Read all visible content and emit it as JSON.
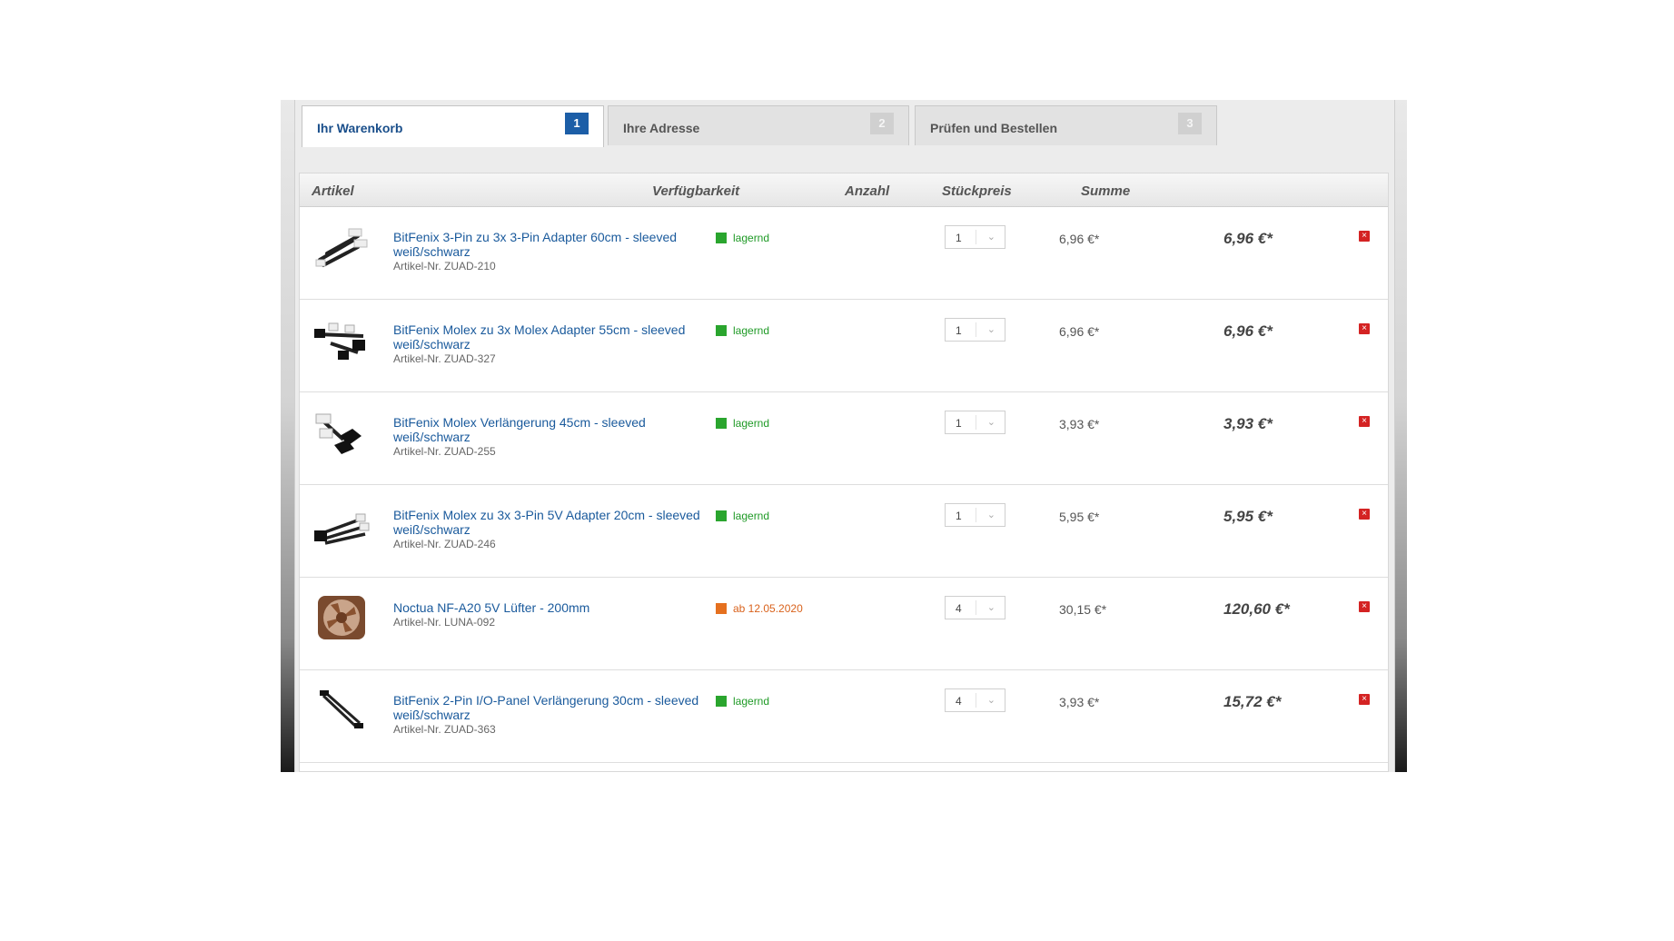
{
  "tabs": [
    {
      "label": "Ihr Warenkorb",
      "num": "1",
      "active": true
    },
    {
      "label": "Ihre Adresse",
      "num": "2",
      "active": false
    },
    {
      "label": "Prüfen und Bestellen",
      "num": "3",
      "active": false
    }
  ],
  "columns": {
    "artikel": "Artikel",
    "verfuegbarkeit": "Verfügbarkeit",
    "anzahl": "Anzahl",
    "stueckpreis": "Stückpreis",
    "summe": "Summe"
  },
  "items": [
    {
      "name": "BitFenix 3-Pin zu 3x 3-Pin Adapter 60cm - sleeved weiß/schwarz",
      "artnr": "Artikel-Nr. ZUAD-210",
      "availability": "lagernd",
      "status": "ok",
      "qty": "1",
      "unit_price": "6,96 €*",
      "sum": "6,96 €*",
      "thumb": "cable-adapter-image"
    },
    {
      "name": "BitFenix Molex zu 3x Molex Adapter 55cm - sleeved weiß/schwarz",
      "artnr": "Artikel-Nr. ZUAD-327",
      "availability": "lagernd",
      "status": "ok",
      "qty": "1",
      "unit_price": "6,96 €*",
      "sum": "6,96 €*",
      "thumb": "molex-adapter-image"
    },
    {
      "name": "BitFenix Molex Verlängerung 45cm - sleeved weiß/schwarz",
      "artnr": "Artikel-Nr. ZUAD-255",
      "availability": "lagernd",
      "status": "ok",
      "qty": "1",
      "unit_price": "3,93 €*",
      "sum": "3,93 €*",
      "thumb": "molex-extension-image"
    },
    {
      "name": "BitFenix Molex zu 3x 3-Pin 5V Adapter 20cm - sleeved weiß/schwarz",
      "artnr": "Artikel-Nr. ZUAD-246",
      "availability": "lagernd",
      "status": "ok",
      "qty": "1",
      "unit_price": "5,95 €*",
      "sum": "5,95 €*",
      "thumb": "molex-3pin-adapter-image"
    },
    {
      "name": "Noctua NF-A20 5V Lüfter - 200mm",
      "artnr": "Artikel-Nr. LUNA-092",
      "availability": "ab 12.05.2020",
      "status": "delayed",
      "qty": "4",
      "unit_price": "30,15 €*",
      "sum": "120,60 €*",
      "thumb": "fan-image"
    },
    {
      "name": "BitFenix 2-Pin I/O-Panel Verlängerung 30cm - sleeved weiß/schwarz",
      "artnr": "Artikel-Nr. ZUAD-363",
      "availability": "lagernd",
      "status": "ok",
      "qty": "4",
      "unit_price": "3,93 €*",
      "sum": "15,72 €*",
      "thumb": "io-panel-cable-image"
    }
  ],
  "icons": {
    "delete": "delete-icon",
    "dropdown": "chevron-down-icon"
  },
  "colors": {
    "link": "#1a5a9c",
    "in_stock": "#2aa52e",
    "delayed": "#e5701f",
    "delete": "#d42323",
    "active_tab_badge": "#1c5ea7"
  }
}
